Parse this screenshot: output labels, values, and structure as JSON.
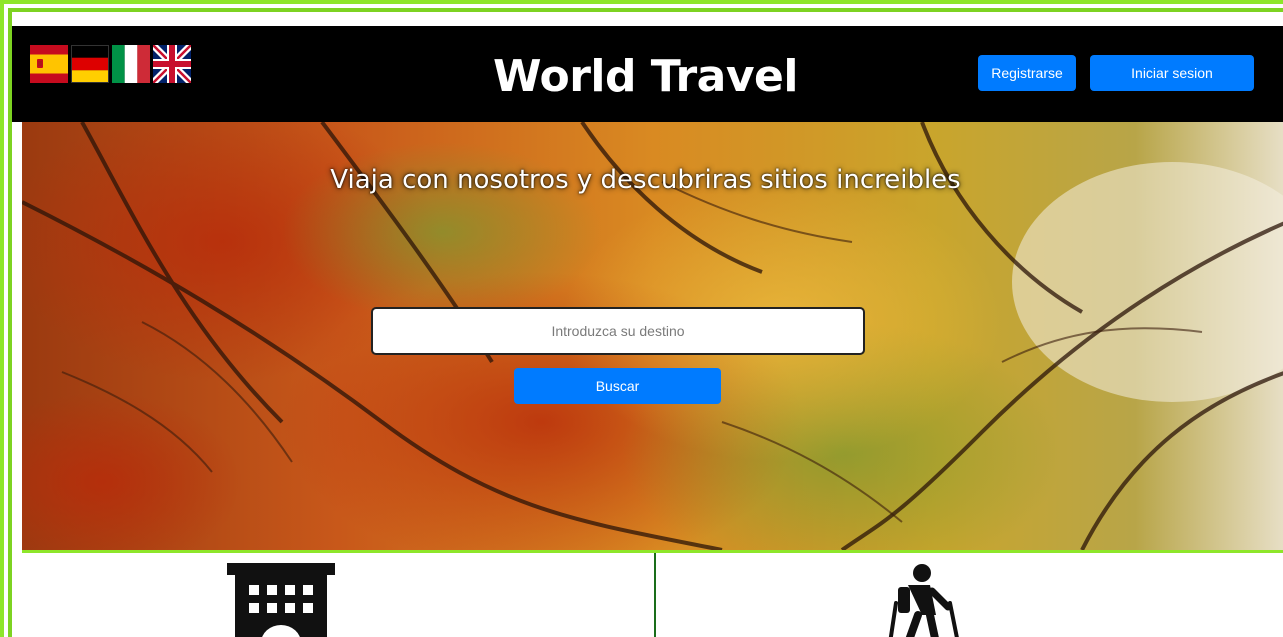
{
  "header": {
    "title": "World Travel",
    "register_label": "Registrarse",
    "login_label": "Iniciar sesion",
    "languages": [
      {
        "icon": "spain-flag-icon"
      },
      {
        "icon": "germany-flag-icon"
      },
      {
        "icon": "italy-flag-icon"
      },
      {
        "icon": "uk-flag-icon"
      }
    ]
  },
  "hero": {
    "headline": "Viaja con nosotros y descubriras sitios increibles",
    "search_placeholder": "Introduzca su destino",
    "search_value": "",
    "search_button": "Buscar"
  },
  "categories": [
    {
      "icon": "hotel-icon"
    },
    {
      "icon": "hiking-icon"
    }
  ],
  "colors": {
    "accent_blue": "#007bff",
    "frame_green": "#8ee62a",
    "header_bg": "#000000",
    "divider_green": "#1a6d1a"
  }
}
